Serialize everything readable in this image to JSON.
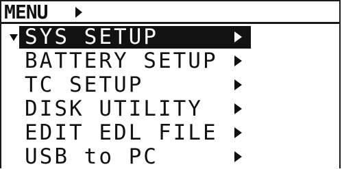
{
  "menu": {
    "title": "MENU",
    "items": [
      {
        "label": "SYS SETUP",
        "selected": true
      },
      {
        "label": "BATTERY SETUP",
        "selected": false
      },
      {
        "label": "TC SETUP",
        "selected": false
      },
      {
        "label": "DISK UTILITY",
        "selected": false
      },
      {
        "label": "EDIT EDL FILE",
        "selected": false
      },
      {
        "label": "USB to PC",
        "selected": false
      }
    ]
  },
  "icons": {
    "title_arrow": "right-triangle-icon",
    "cursor": "down-triangle-icon",
    "submenu_arrow": "right-triangle-icon"
  },
  "colors": {
    "foreground": "#111111",
    "background": "#ffffff",
    "highlight": "#121212"
  }
}
